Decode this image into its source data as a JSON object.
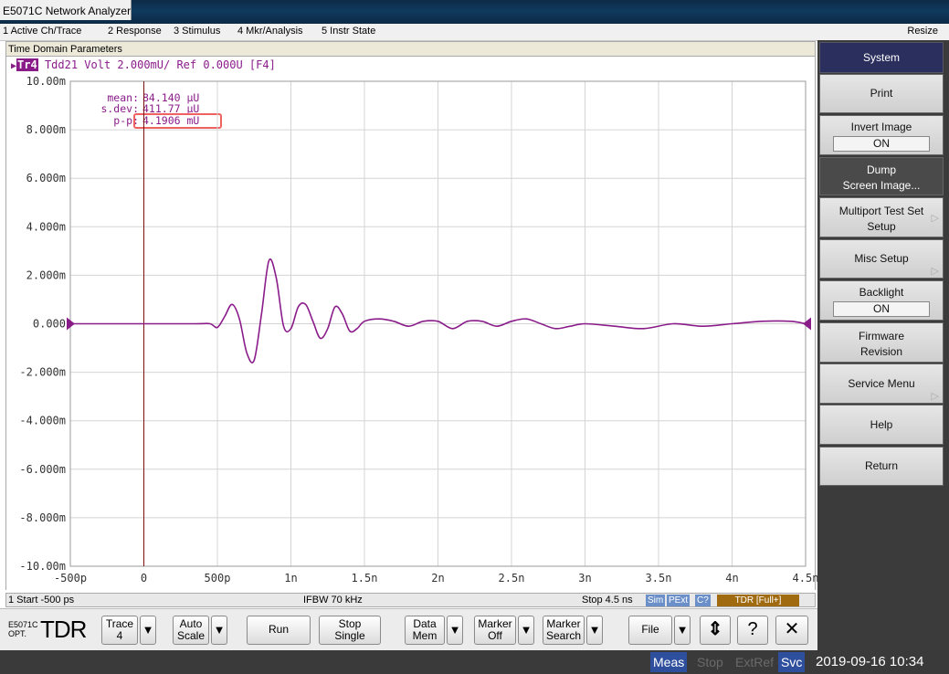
{
  "window": {
    "title": "E5071C Network Analyzer"
  },
  "menu": {
    "items": [
      "1 Active Ch/Trace",
      "2 Response",
      "3 Stimulus",
      "4 Mkr/Analysis",
      "5 Instr State"
    ],
    "resize": "Resize"
  },
  "panel": {
    "label": "Time Domain Parameters"
  },
  "trace": {
    "badge": "Tr4",
    "text": "Tdd21 Volt 2.000mU/ Ref 0.000U [F4]"
  },
  "stats": {
    "mean_label": "mean:",
    "mean_value": "84.140 µU",
    "sdev_label": "s.dev:",
    "sdev_value": "411.77 µU",
    "pp_label": "p-p:",
    "pp_value": "4.1906 mU"
  },
  "y_ticks": [
    "10.00m",
    "8.000m",
    "6.000m",
    "4.000m",
    "2.000m",
    "0.000",
    "-2.000m",
    "-4.000m",
    "-6.000m",
    "-8.000m",
    "-10.00m"
  ],
  "x_ticks": [
    "-500p",
    "0",
    "500p",
    "1n",
    "1.5n",
    "2n",
    "2.5n",
    "3n",
    "3.5n",
    "4n",
    "4.5n"
  ],
  "status": {
    "start": "1  Start -500 ps",
    "ifbw": "IFBW 70 kHz",
    "stop": "Stop 4.5 ns",
    "badges": [
      "Sim",
      "PExt",
      "C?",
      "TDR [Full+]"
    ]
  },
  "toolbar": {
    "model_line1": "E5071C",
    "model_line2": "OPT.",
    "model_big": "TDR",
    "trace_label": "Trace",
    "trace_value": "4",
    "auto_label": "Auto",
    "auto_label2": "Scale",
    "run_label": "Run",
    "stop_label": "Stop",
    "stop_label2": "Single",
    "data_label": "Data",
    "data_label2": "Mem",
    "marker_label": "Marker",
    "marker_label2": "Off",
    "msearch_label": "Marker",
    "msearch_label2": "Search",
    "file_label": "File",
    "drop_glyph": "▼",
    "updown_glyph": "⇕",
    "help_glyph": "?",
    "close_glyph": "✕"
  },
  "bottom": {
    "meas": "Meas",
    "stop": "Stop",
    "extref": "ExtRef",
    "svc": "Svc",
    "datetime": "2019-09-16 10:34"
  },
  "softkeys": {
    "system": "System",
    "print": "Print",
    "invert_label": "Invert Image",
    "invert_state": "ON",
    "dump_line1": "Dump",
    "dump_line2": "Screen Image...",
    "multiport_line1": "Multiport Test Set",
    "multiport_line2": "Setup",
    "misc": "Misc Setup",
    "backlight_label": "Backlight",
    "backlight_state": "ON",
    "firmware_line1": "Firmware",
    "firmware_line2": "Revision",
    "service": "Service Menu",
    "help": "Help",
    "return": "Return",
    "arrow": "▷"
  },
  "colors": {
    "trace": "#8a1c8a",
    "highlight": "#f06262",
    "softkey_active": "#2a2f5e"
  },
  "chart_data": {
    "type": "line",
    "title": "",
    "xlabel": "",
    "ylabel": "",
    "xlim": [
      -5e-10,
      4.5e-09
    ],
    "ylim": [
      -0.01,
      0.01
    ],
    "grid": true,
    "series": [
      {
        "x": [
          -5e-10,
          0,
          3.5e-10,
          4.5e-10,
          5e-10,
          5.5e-10,
          6e-10,
          6.5e-10,
          7e-10,
          7.5e-10,
          8e-10,
          8.5e-10,
          9e-10,
          9.5e-10,
          1e-09,
          1.05e-09,
          1.1e-09,
          1.15e-09,
          1.2e-09,
          1.25e-09,
          1.3e-09,
          1.35e-09,
          1.4e-09,
          1.45e-09,
          1.5e-09,
          1.6e-09,
          1.7e-09,
          1.8e-09,
          1.9e-09,
          2e-09,
          2.1e-09,
          2.2e-09,
          2.3e-09,
          2.4e-09,
          2.5e-09,
          2.6e-09,
          2.7e-09,
          2.8e-09,
          2.9e-09,
          3e-09,
          3.2e-09,
          3.4e-09,
          3.6e-09,
          3.8e-09,
          4e-09,
          4.2e-09,
          4.4e-09,
          4.5e-09
        ],
        "y": [
          0,
          0,
          0,
          0,
          -0.00015,
          0.0003,
          0.0008,
          0.0002,
          -0.0012,
          -0.0015,
          0.0004,
          0.0026,
          0.0019,
          -0.0001,
          -0.0002,
          0.0007,
          0.0008,
          0.0001,
          -0.0006,
          -0.0002,
          0.0007,
          0.0004,
          -0.0003,
          -0.0002,
          0.0001,
          0.0002,
          0.0001,
          -0.0001,
          0.0001,
          0.0001,
          -0.0002,
          0.0001,
          0.0001,
          -0.0001,
          0.0001,
          0.0002,
          0.0,
          -0.0002,
          -0.0001,
          0.0,
          -0.0001,
          -0.0002,
          0.0,
          -0.0001,
          0.0,
          0.0001,
          0.0001,
          0.0
        ]
      }
    ]
  }
}
